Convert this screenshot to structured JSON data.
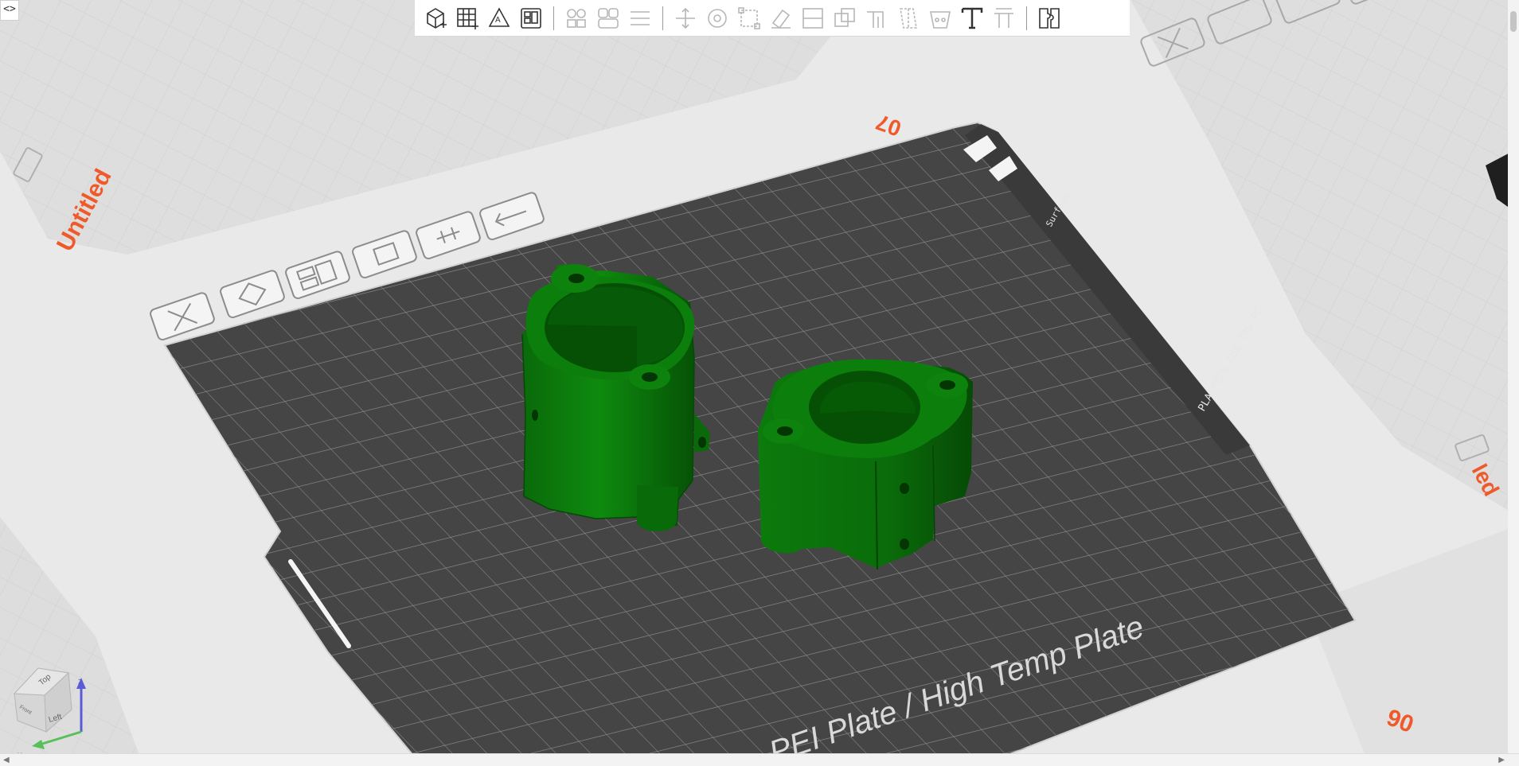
{
  "window": {
    "collapse_glyph": "<>"
  },
  "toolbar": {
    "groups": [
      [
        "add-cube",
        "add-plate",
        "auto-orient",
        "arrange"
      ],
      [
        "split-objects",
        "split-parts",
        "layers"
      ],
      [
        "move",
        "rotate",
        "scale",
        "erase",
        "cut",
        "boolean",
        "support-paint",
        "seam-paint",
        "mmu-paint",
        "text",
        "measure"
      ],
      [
        "assembly"
      ]
    ]
  },
  "plate": {
    "current_label": "Untitled",
    "neighbor_label": "Untitled",
    "neighbor_partial": "led",
    "plate_name": "PEI Plate / High Temp Plate",
    "sticker_text": "Surface",
    "material_text": "PLA PETG ABS TPU PC",
    "tick_top": "07",
    "tick_right": "06"
  },
  "nav_cube": {
    "top": "Top",
    "left": "Left",
    "front": "Front",
    "axes": [
      "x",
      "y",
      "z"
    ]
  },
  "colors": {
    "background": "#e9e9e9",
    "bed": "#454545",
    "bed_grid": "#8e8e8e",
    "model": "#0b7a0b",
    "model_dark": "#075607",
    "accent": "#f05a2a"
  }
}
